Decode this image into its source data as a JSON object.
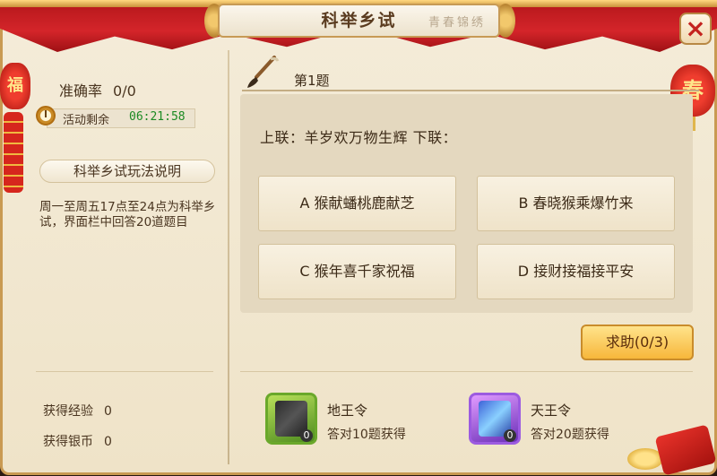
{
  "title": {
    "text": "科举乡试",
    "decoration": "青春锦绣"
  },
  "close_label": "×",
  "left": {
    "accuracy_label": "准确率",
    "accuracy_value": "0/0",
    "timer_label": "活动剩余",
    "timer_value": "06:21:58",
    "rules_title": "科举乡试玩法说明",
    "rules_body": "周一至周五17点至24点为科举乡试，界面栏中回答20道题目",
    "rewards": [
      {
        "label": "获得经验",
        "value": "0"
      },
      {
        "label": "获得银币",
        "value": "0"
      }
    ],
    "lantern_char": "福"
  },
  "right_lantern_char": "春",
  "question": {
    "number_label": "第1题",
    "text": "上联：羊岁欢万物生辉  下联：",
    "options": [
      {
        "label": "A 猴献蟠桃鹿献芝"
      },
      {
        "label": "B 春晓猴乘爆竹来"
      },
      {
        "label": "C 猴年喜千家祝福"
      },
      {
        "label": "D 接财接福接平安"
      }
    ]
  },
  "help_button": "求助(0/3)",
  "items": [
    {
      "name": "地王令",
      "desc": "答对10题获得",
      "count": "0",
      "icon": "black-scroll-icon"
    },
    {
      "name": "天王令",
      "desc": "答对20题获得",
      "count": "0",
      "icon": "blue-scroll-icon"
    }
  ],
  "colors": {
    "accent_red": "#d4252a",
    "gold": "#c99a52",
    "timer_green": "#1b8a22"
  }
}
